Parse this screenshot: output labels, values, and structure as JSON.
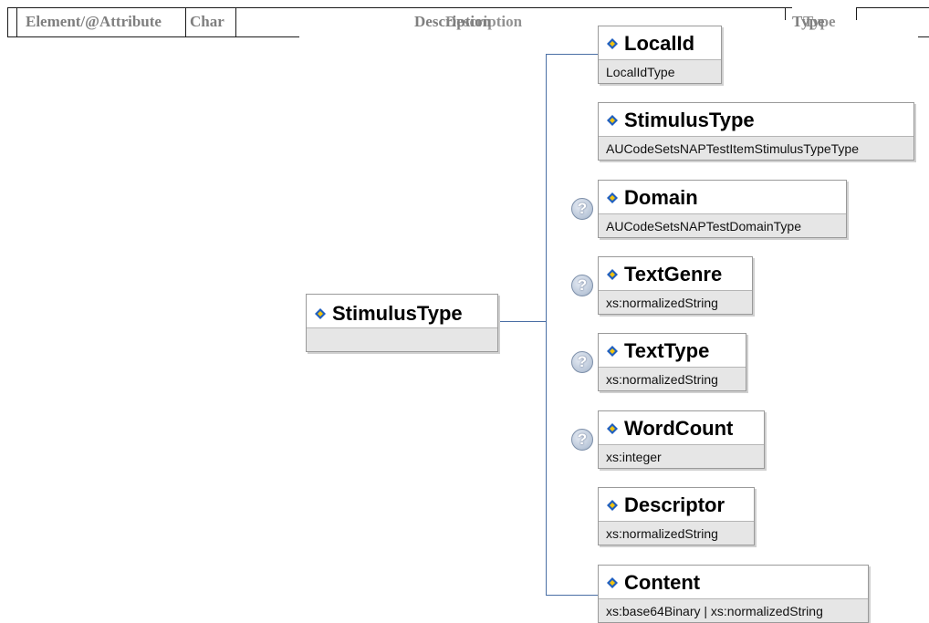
{
  "header": {
    "col_element": "Element/@Attribute",
    "col_char": "Char",
    "col_description_a": "Description",
    "col_description_b": "Description",
    "col_type_a": "Type",
    "col_type_b": "Type"
  },
  "root": {
    "name": "StimulusType",
    "type": "",
    "icon": "element-icon"
  },
  "children": [
    {
      "name": "LocalId",
      "type": "LocalIdType",
      "optional": false
    },
    {
      "name": "StimulusType",
      "type": "AUCodeSetsNAPTestItemStimulusTypeType",
      "optional": false
    },
    {
      "name": "Domain",
      "type": "AUCodeSetsNAPTestDomainType",
      "optional": true
    },
    {
      "name": "TextGenre",
      "type": "xs:normalizedString",
      "optional": true
    },
    {
      "name": "TextType",
      "type": "xs:normalizedString",
      "optional": true
    },
    {
      "name": "WordCount",
      "type": "xs:integer",
      "optional": true
    },
    {
      "name": "Descriptor",
      "type": "xs:normalizedString",
      "optional": false
    },
    {
      "name": "Content",
      "type": "xs:base64Binary | xs:normalizedString",
      "optional": false
    }
  ],
  "optional_marker": "?",
  "colors": {
    "connector": "#4a6fa5",
    "type_band": "#e6e6e6",
    "icon_blue": "#1f5fbf",
    "icon_yellow": "#f2c40f"
  }
}
